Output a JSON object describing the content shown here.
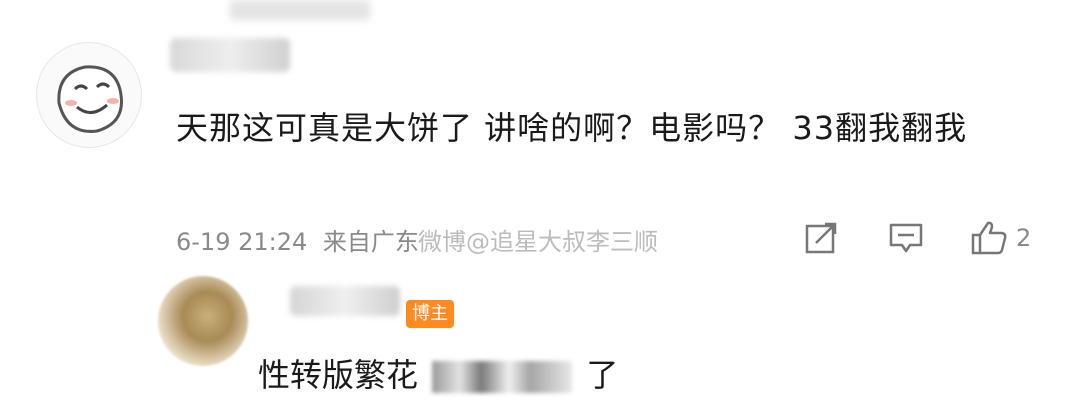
{
  "comment": {
    "text": "天那这可真是大饼了 讲啥的啊？电影吗？ 33翻我翻我",
    "date": "6-19 21:24",
    "source": "来自广东",
    "like_count": "2",
    "watermark": "微博@追星大叔李三顺"
  },
  "reply": {
    "badge": "博主",
    "text_before": "性转版繁花",
    "text_after": "了"
  }
}
